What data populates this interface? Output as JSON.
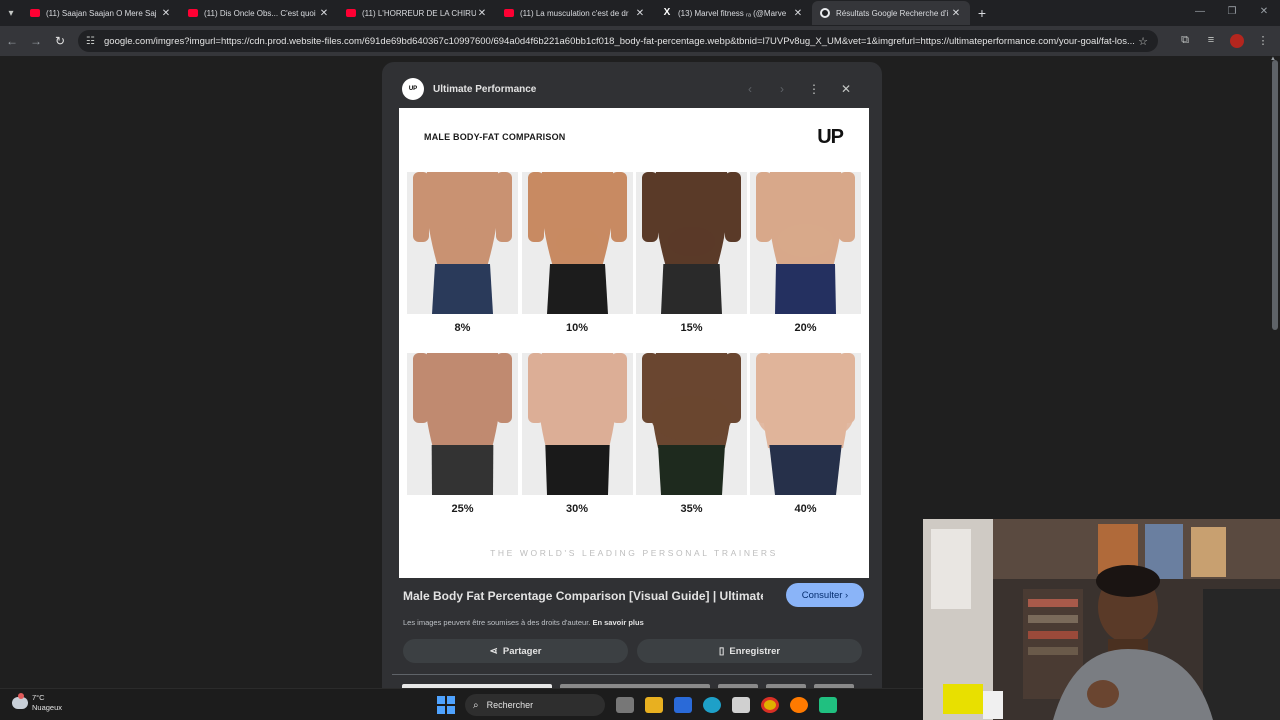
{
  "browser": {
    "tabs": [
      {
        "title": "(11) Saajan Saajan O Mere Saj",
        "icon": "youtube-icon",
        "active": false
      },
      {
        "title": "(11) Dis Oncle Obs... C'est quoi",
        "icon": "youtube-icon",
        "active": false
      },
      {
        "title": "(11) L'HORREUR DE LA CHIRUR",
        "icon": "youtube-icon",
        "active": false
      },
      {
        "title": "(11) La musculation c'est de dr",
        "icon": "youtube-icon",
        "active": false
      },
      {
        "title": "(13) Marvel fitness ᵣₐ (@Marve",
        "icon": "x-icon",
        "active": false
      },
      {
        "title": "Résultats Google Recherche d'i",
        "icon": "google-icon",
        "active": true
      }
    ],
    "url": "google.com/imgres?imgurl=https://cdn.prod.website-files.com/691de69bd640367c10997600/694a0d4f6b221a60bb1cf018_body-fat-percentage.webp&tbnid=l7UVPv8ug_X_UM&vet=1&imgrefurl=https://ultimateperformance.com/your-goal/fat-los..."
  },
  "viewer": {
    "source_name": "Ultimate Performance",
    "source_logo": "UP",
    "image": {
      "title": "MALE BODY-FAT COMPARISON",
      "logo": "UP",
      "percentages": [
        "8%",
        "10%",
        "15%",
        "20%",
        "25%",
        "30%",
        "35%",
        "40%"
      ],
      "footer": "THE WORLD'S LEADING PERSONAL TRAINERS"
    },
    "caption": "Male Body Fat Percentage Comparison [Visual Guide] | Ultimate ...",
    "visit_label": "Consulter",
    "rights_text": "Les images peuvent être soumises à des droits d'auteur.",
    "rights_link": "En savoir plus",
    "share_label": "Partager",
    "save_label": "Enregistrer"
  },
  "taskbar": {
    "temperature": "7°C",
    "weather": "Nuageux",
    "search_placeholder": "Rechercher"
  },
  "colors": {
    "accent": "#8ab4f8",
    "page_bg": "#1f1f1f",
    "panel_bg": "#303134"
  }
}
